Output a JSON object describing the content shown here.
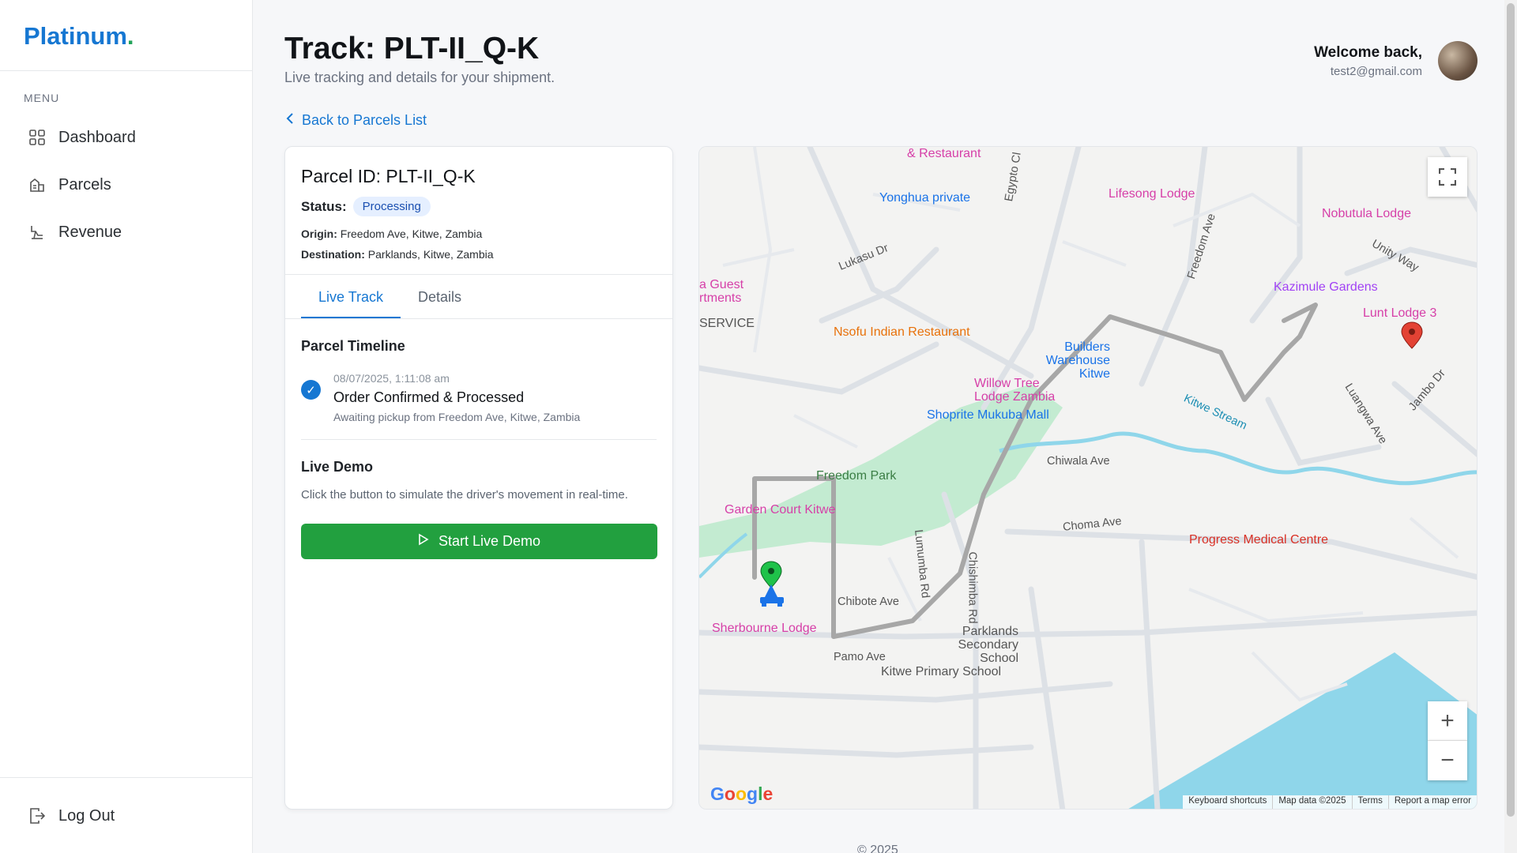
{
  "sidebar": {
    "brand": "Platinum",
    "brand_dot": ".",
    "menu_label": "MENU",
    "items": [
      {
        "label": "Dashboard",
        "icon": "grid-icon"
      },
      {
        "label": "Parcels",
        "icon": "parcel-icon"
      },
      {
        "label": "Revenue",
        "icon": "revenue-icon"
      }
    ],
    "logout": "Log Out"
  },
  "header": {
    "title": "Track: PLT-II_Q-K",
    "subtitle": "Live tracking and details for your shipment.",
    "welcome": "Welcome back,",
    "email": "test2@gmail.com"
  },
  "back_link": "Back to Parcels List",
  "parcel": {
    "id_label": "Parcel ID: PLT-II_Q-K",
    "status_label": "Status:",
    "status": "Processing",
    "origin_label": "Origin:",
    "origin": "Freedom Ave, Kitwe, Zambia",
    "destination_label": "Destination:",
    "destination": "Parklands, Kitwe, Zambia"
  },
  "tabs": [
    "Live Track",
    "Details"
  ],
  "timeline": {
    "title": "Parcel Timeline",
    "events": [
      {
        "time": "08/07/2025, 1:11:08 am",
        "title": "Order Confirmed & Processed",
        "subtitle": "Awaiting pickup from Freedom Ave, Kitwe, Zambia"
      }
    ]
  },
  "demo": {
    "title": "Live Demo",
    "description": "Click the button to simulate the driver's movement in real-time.",
    "button": "Start Live Demo"
  },
  "map": {
    "pois": [
      {
        "label": "& Restaurant",
        "color": "#d63fa8"
      },
      {
        "label": "Yonghua private",
        "color": "#1a73e8"
      },
      {
        "label": "Lifesong Lodge",
        "color": "#d63fa8"
      },
      {
        "label": "Nobutula Lodge",
        "color": "#d63fa8"
      },
      {
        "label": "Kazimule Gardens",
        "color": "#a142f4"
      },
      {
        "label": "Lunt Lodge 3",
        "color": "#d63fa8"
      },
      {
        "label": "Nsofu Indian Restaurant",
        "color": "#e8710a"
      },
      {
        "label": "Builders Warehouse Kitwe",
        "color": "#1a73e8"
      },
      {
        "label": "Willow Tree Lodge Zambia",
        "color": "#d63fa8"
      },
      {
        "label": "Shoprite Mukuba Mall",
        "color": "#1a73e8"
      },
      {
        "label": "Freedom Park",
        "color": "#3a7d44"
      },
      {
        "label": "Garden Court Kitwe",
        "color": "#d63fa8"
      },
      {
        "label": "Progress Medical Centre",
        "color": "#d93025"
      },
      {
        "label": "Sherbourne Lodge",
        "color": "#d63fa8"
      },
      {
        "label": "Parklands Secondary School",
        "color": "#555555"
      },
      {
        "label": "Kitwe Primary School",
        "color": "#555555"
      },
      {
        "label": "a Guest rtments",
        "color": "#d63fa8"
      },
      {
        "label": "SERVICE",
        "color": "#555555"
      }
    ],
    "streets": [
      "Freedom Ave",
      "Lukasu Dr",
      "Chiwala Ave",
      "Choma Ave",
      "Lumumba Rd",
      "Chishimba Rd",
      "Chibote Ave",
      "Pamo Ave",
      "Luangwa Ave",
      "Jambo Dr",
      "Unity Way",
      "Kitwe Stream",
      "Egypto Cl"
    ],
    "attribution": [
      "Keyboard shortcuts",
      "Map data ©2025",
      "Terms",
      "Report a map error"
    ],
    "logo": "Google"
  },
  "footer": "© 2025"
}
